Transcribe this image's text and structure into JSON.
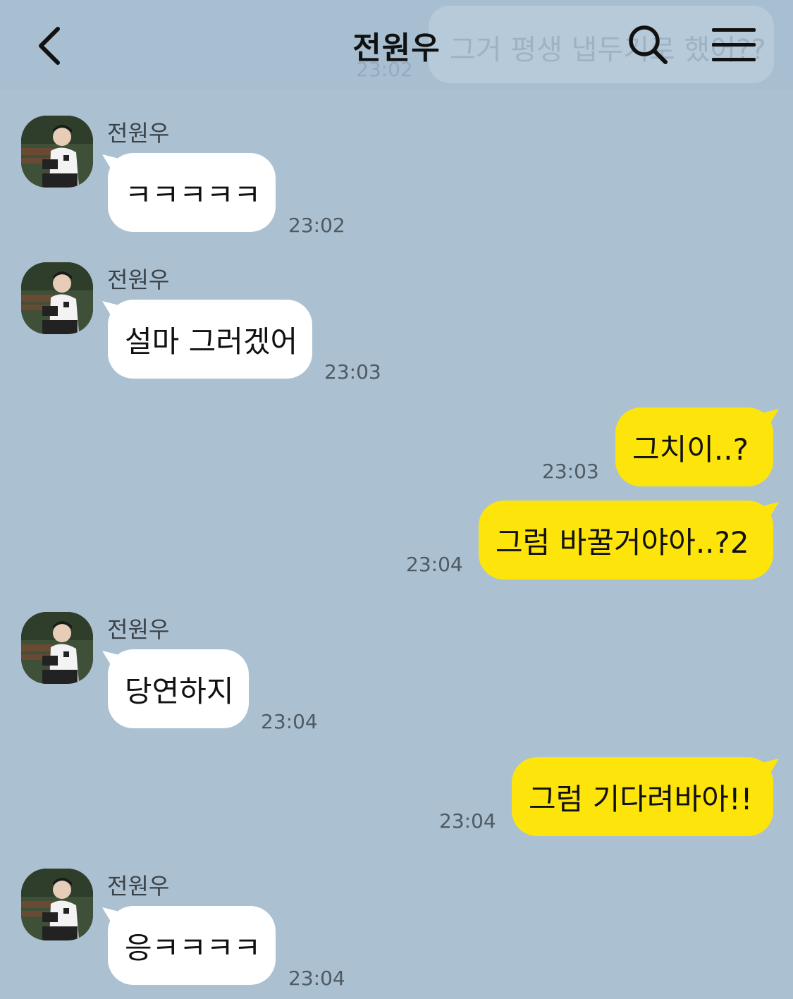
{
  "header": {
    "title": "전원우",
    "back_icon": "chevron-left-icon",
    "search_icon": "search-icon",
    "menu_icon": "hamburger-menu-icon",
    "ghost_text": "그거 평생 냅두기로 했어??",
    "ghost_time": "23:02"
  },
  "colors": {
    "background": "#abc1d1",
    "incoming_bubble": "#ffffff",
    "outgoing_bubble": "#fde50c"
  },
  "messages": [
    {
      "direction": "in",
      "sender": "전원우",
      "text": "ㅋㅋㅋㅋㅋ",
      "time": "23:02"
    },
    {
      "direction": "in",
      "sender": "전원우",
      "text": "설마 그러겠어",
      "time": "23:03"
    },
    {
      "direction": "out",
      "text": "그치이..?",
      "time": "23:03"
    },
    {
      "direction": "out",
      "text": "그럼 바꿀거야아..?2",
      "time": "23:04"
    },
    {
      "direction": "in",
      "sender": "전원우",
      "text": "당연하지",
      "time": "23:04"
    },
    {
      "direction": "out",
      "text": "그럼 기다려바아!!",
      "time": "23:04"
    },
    {
      "direction": "in",
      "sender": "전원우",
      "text": "응ㅋㅋㅋㅋ",
      "time": "23:04"
    }
  ]
}
